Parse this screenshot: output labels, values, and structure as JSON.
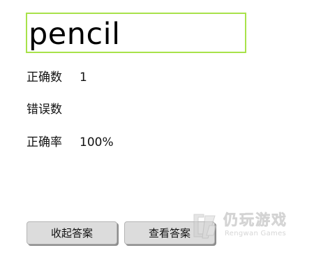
{
  "word_input": {
    "value": "pencil"
  },
  "stats": {
    "correct_label": "正确数",
    "correct_value": "1",
    "wrong_label": "错误数",
    "wrong_value": "",
    "rate_label": "正确率",
    "rate_value": "100%"
  },
  "buttons": {
    "collapse_answer": "收起答案",
    "view_answer": "查看答案"
  },
  "watermark": {
    "title": "仍玩游戏",
    "subtitle": "Rengwan Games",
    "logo_icon": "rengwan-logo-icon"
  },
  "colors": {
    "input_border": "#a8e24a",
    "button_bg": "#dcdcdc"
  }
}
